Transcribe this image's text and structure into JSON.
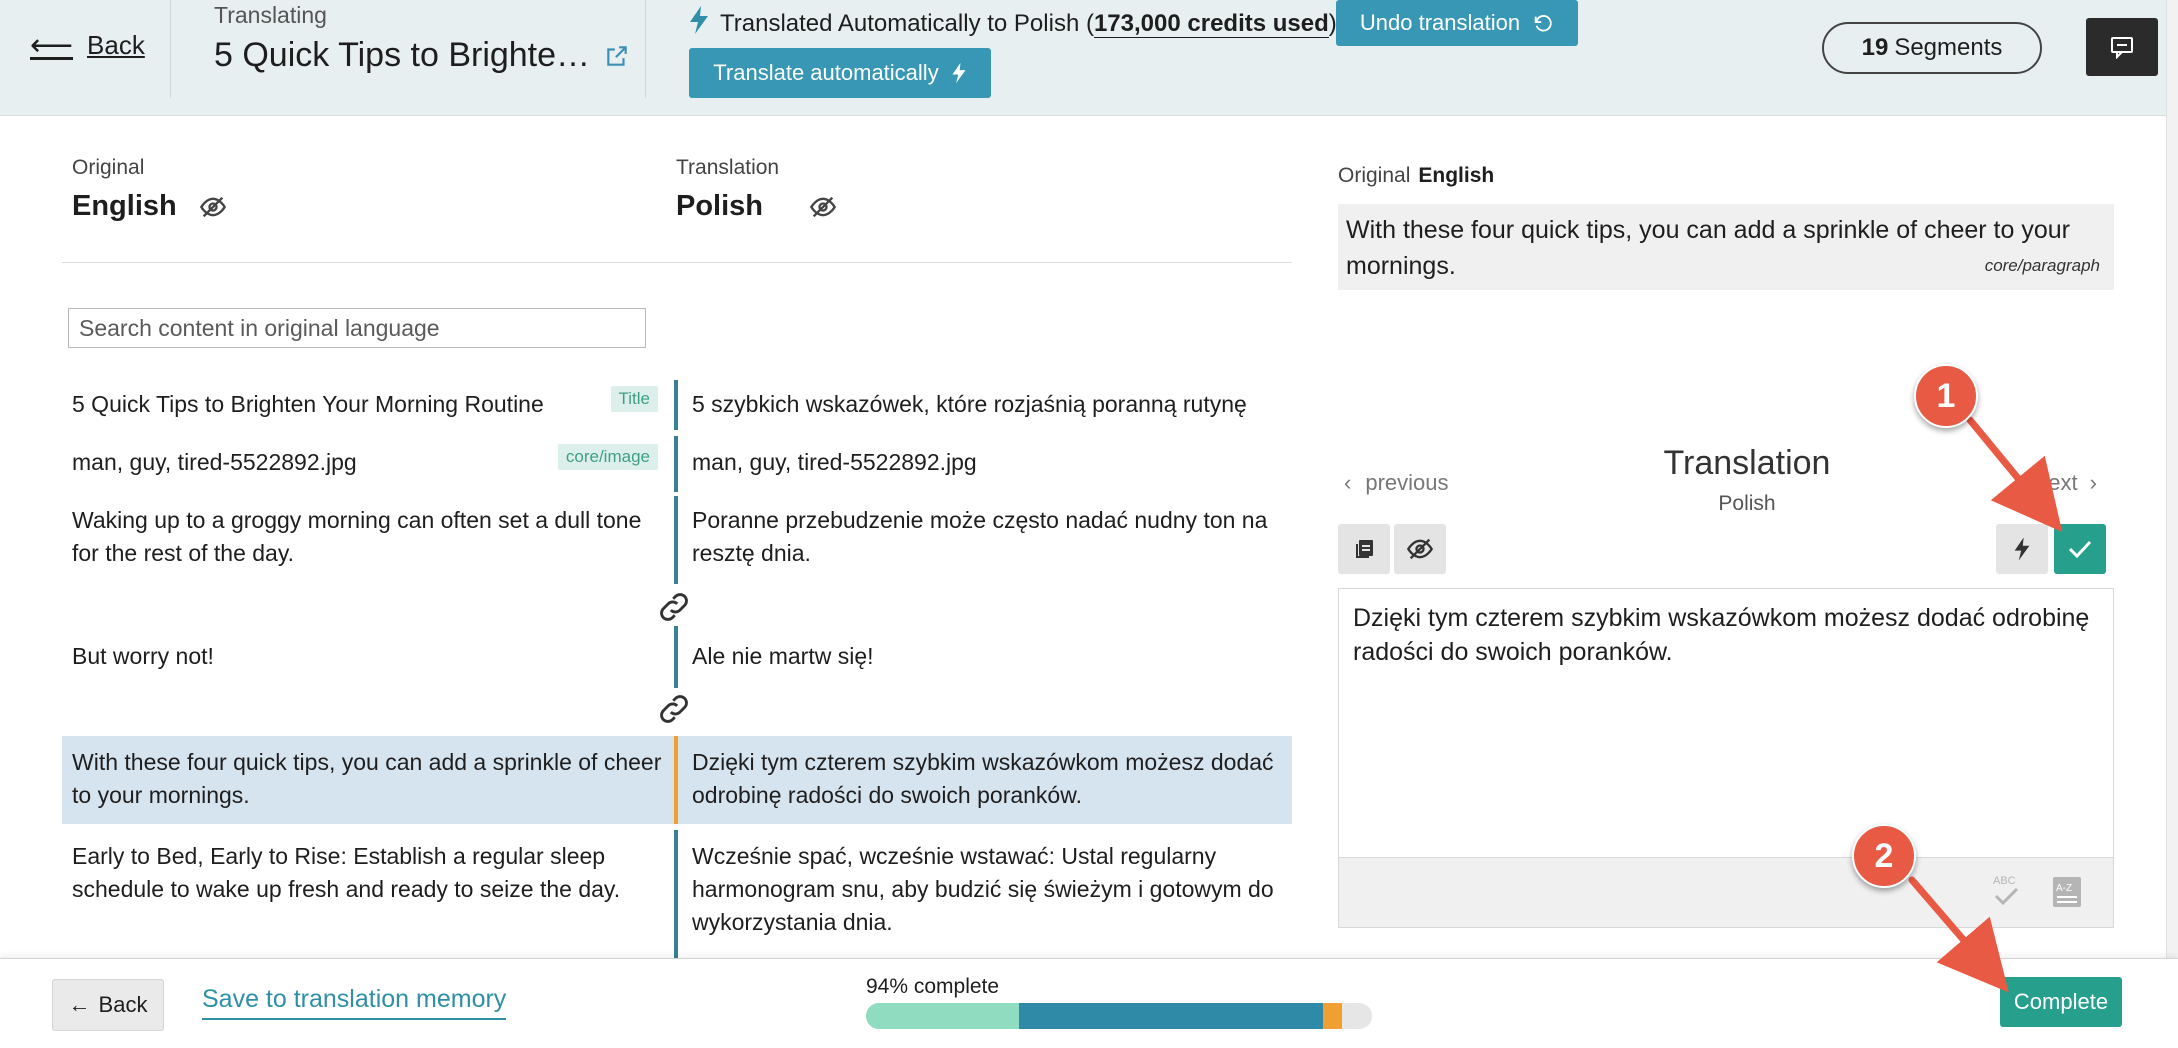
{
  "header": {
    "back_label": "Back",
    "kicker": "Translating",
    "doc_title": "5 Quick Tips to Brighte…",
    "auto_status_prefix": "Translated Automatically to Polish (",
    "auto_status_credits": "173,000 credits used",
    "auto_status_suffix": ")",
    "undo_label": "Undo translation",
    "translate_auto_label": "Translate automatically",
    "segments_count": "19",
    "segments_label": "Segments"
  },
  "columns": {
    "original_kicker": "Original",
    "original_lang": "English",
    "translation_kicker": "Translation",
    "translation_lang": "Polish"
  },
  "search": {
    "placeholder": "Search content in original language"
  },
  "segments": [
    {
      "original": "5 Quick Tips to Brighten Your Morning Routine",
      "tag": "Title",
      "translation": "5 szybkich wskazówek, które rozjaśnią poranną rutynę"
    },
    {
      "original": "man, guy, tired-5522892.jpg",
      "tag": "core/image",
      "translation": "man, guy, tired-5522892.jpg"
    },
    {
      "original": "Waking up to a groggy morning can often set a dull tone for the rest of the day.",
      "tag": "",
      "translation": "Poranne przebudzenie może często nadać nudny ton na resztę dnia."
    },
    {
      "original": "But worry not!",
      "tag": "",
      "translation": "Ale nie martw się!"
    },
    {
      "original": "With these four quick tips, you can add a sprinkle of cheer to your mornings.",
      "tag": "",
      "translation": "Dzięki tym czterem szybkim wskazówkom możesz dodać odrobinę radości do swoich poranków.",
      "active": true
    },
    {
      "original": "Early to Bed, Early to Rise: Establish a regular sleep schedule to wake up fresh and ready to seize the day.",
      "tag": "",
      "translation": "Wcześnie spać, wcześnie wstawać: Ustal regularny harmonogram snu, aby budzić się świeżym i gotowym do wykorzystania dnia."
    }
  ],
  "right_panel": {
    "original_label": "Original",
    "original_lang": "English",
    "original_text": "With these four quick tips, you can add a sprinkle of cheer to your mornings.",
    "block_type": "core/paragraph",
    "previous_label": "previous",
    "next_label": "next",
    "translation_title": "Translation",
    "translation_lang": "Polish",
    "editor_text": "Dzięki tym czterem szybkim wskazówkom możesz dodać odrobinę radości do swoich poranków."
  },
  "footer": {
    "back_label": "Back",
    "save_tm_label": "Save to translation memory",
    "progress_label": "94% complete",
    "progress_segments": [
      {
        "name": "translation-memory",
        "fraction": 0.303,
        "color": "#8fdcc0"
      },
      {
        "name": "automatic",
        "fraction": 0.6,
        "color": "#2e8aa6"
      },
      {
        "name": "remaining",
        "fraction": 0.037,
        "color": "#f0a030"
      }
    ],
    "complete_label": "Complete"
  },
  "callouts": {
    "one": "1",
    "two": "2"
  },
  "colors": {
    "accent": "#3797b5",
    "success": "#26a08d",
    "callout": "#e85a44",
    "active_row": "#d6e4f0"
  }
}
